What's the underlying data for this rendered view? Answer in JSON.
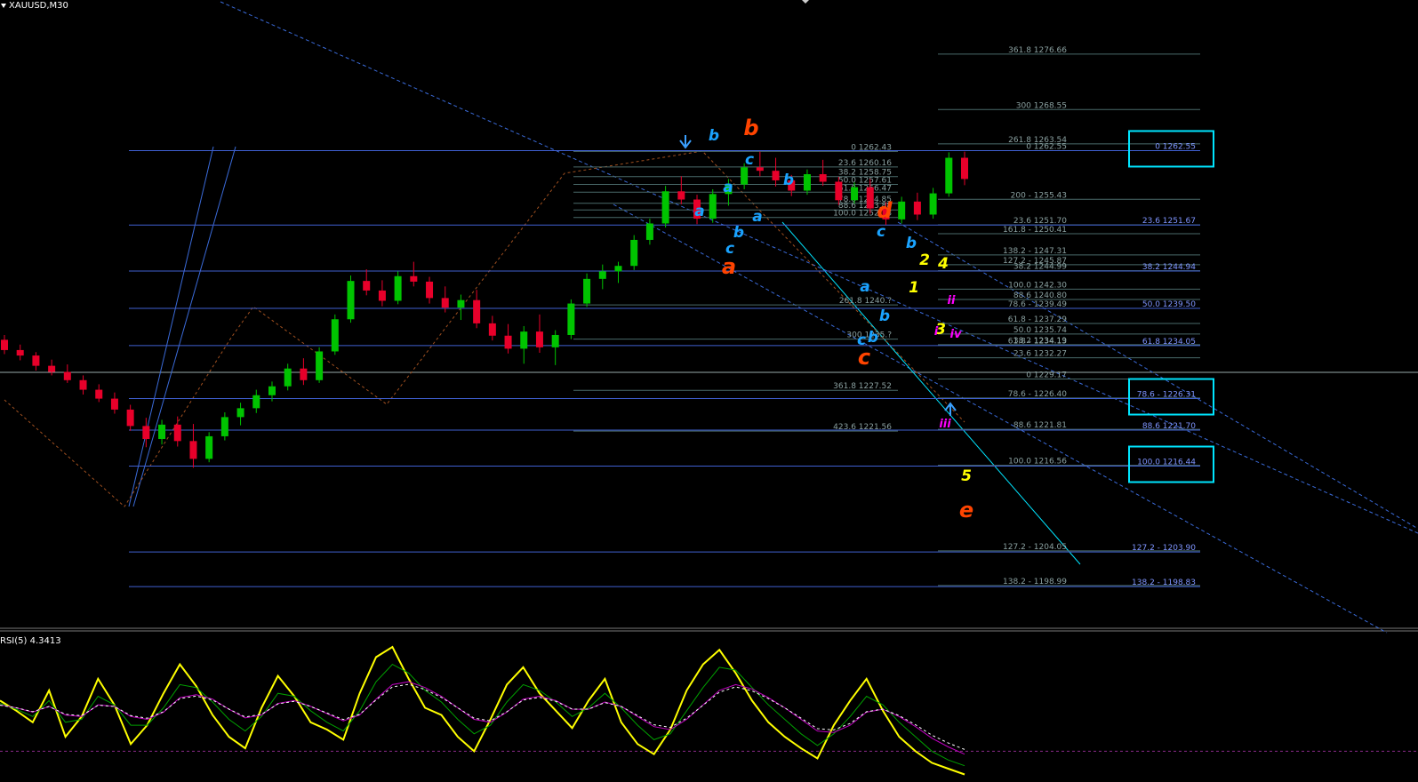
{
  "symbol_title": "XAUUSD,M30",
  "indicator_title": "RSI(5) 4.3413",
  "colors": {
    "background": "#000000",
    "bull": "#00c400",
    "bear": "#e8002a",
    "fib_line": "#4a6a6a",
    "fib_text": "#8aa0a0",
    "level_line": "#3f5fd0",
    "level_text": "#7f95ff",
    "channel": "#3a6ad8",
    "box": "#00e5ff",
    "rsi": "#ffff00"
  },
  "chart_data": [
    {
      "type": "candlestick",
      "title": "XAUUSD,M30",
      "ylim": [
        1193,
        1283
      ],
      "ohlc": [
        [
          1234.9,
          1235.6,
          1232.8,
          1233.4
        ],
        [
          1233.4,
          1234.2,
          1231.9,
          1232.6
        ],
        [
          1232.6,
          1233.1,
          1230.4,
          1231.1
        ],
        [
          1231.1,
          1232.0,
          1229.7,
          1230.2
        ],
        [
          1230.2,
          1231.3,
          1228.6,
          1229.0
        ],
        [
          1229.0,
          1229.7,
          1226.9,
          1227.6
        ],
        [
          1227.6,
          1228.4,
          1225.8,
          1226.3
        ],
        [
          1226.3,
          1227.2,
          1224.1,
          1224.7
        ],
        [
          1224.7,
          1225.4,
          1221.6,
          1222.3
        ],
        [
          1222.3,
          1223.5,
          1219.2,
          1220.4
        ],
        [
          1220.4,
          1223.2,
          1219.6,
          1222.5
        ],
        [
          1222.5,
          1223.7,
          1219.3,
          1220.1
        ],
        [
          1220.1,
          1222.6,
          1216.2,
          1217.5
        ],
        [
          1217.5,
          1221.4,
          1217.0,
          1220.8
        ],
        [
          1220.8,
          1224.3,
          1220.2,
          1223.6
        ],
        [
          1223.6,
          1225.7,
          1222.4,
          1224.9
        ],
        [
          1224.9,
          1227.6,
          1224.2,
          1226.8
        ],
        [
          1226.8,
          1228.8,
          1225.9,
          1228.1
        ],
        [
          1228.1,
          1231.4,
          1227.5,
          1230.7
        ],
        [
          1230.7,
          1232.2,
          1228.3,
          1229.0
        ],
        [
          1229.0,
          1233.8,
          1228.6,
          1233.2
        ],
        [
          1233.2,
          1238.6,
          1232.7,
          1237.9
        ],
        [
          1237.9,
          1244.3,
          1237.4,
          1243.5
        ],
        [
          1243.5,
          1245.2,
          1241.4,
          1242.1
        ],
        [
          1242.1,
          1243.6,
          1239.8,
          1240.6
        ],
        [
          1240.6,
          1244.9,
          1240.1,
          1244.2
        ],
        [
          1244.2,
          1246.3,
          1242.7,
          1243.4
        ],
        [
          1243.4,
          1244.1,
          1240.2,
          1241.0
        ],
        [
          1241.0,
          1242.7,
          1238.9,
          1239.6
        ],
        [
          1239.6,
          1241.5,
          1237.8,
          1240.7
        ],
        [
          1240.7,
          1242.2,
          1236.6,
          1237.3
        ],
        [
          1237.3,
          1238.4,
          1234.8,
          1235.5
        ],
        [
          1235.5,
          1237.2,
          1232.9,
          1233.6
        ],
        [
          1233.6,
          1236.9,
          1231.4,
          1236.1
        ],
        [
          1236.1,
          1238.6,
          1233.0,
          1233.8
        ],
        [
          1233.8,
          1236.3,
          1231.2,
          1235.6
        ],
        [
          1235.6,
          1240.8,
          1235.0,
          1240.2
        ],
        [
          1240.2,
          1244.6,
          1239.7,
          1243.8
        ],
        [
          1243.8,
          1245.9,
          1242.3,
          1244.9
        ],
        [
          1244.9,
          1246.3,
          1243.2,
          1245.7
        ],
        [
          1245.7,
          1250.2,
          1245.1,
          1249.5
        ],
        [
          1249.5,
          1252.6,
          1248.8,
          1251.9
        ],
        [
          1251.9,
          1257.4,
          1251.3,
          1256.6
        ],
        [
          1256.6,
          1258.8,
          1254.7,
          1255.4
        ],
        [
          1255.4,
          1256.1,
          1251.8,
          1252.6
        ],
        [
          1252.6,
          1256.9,
          1252.0,
          1256.2
        ],
        [
          1256.2,
          1258.4,
          1254.5,
          1257.6
        ],
        [
          1257.6,
          1260.7,
          1256.9,
          1260.1
        ],
        [
          1260.1,
          1262.4,
          1258.8,
          1259.6
        ],
        [
          1259.6,
          1261.5,
          1257.3,
          1258.2
        ],
        [
          1258.2,
          1259.0,
          1255.9,
          1256.7
        ],
        [
          1256.7,
          1259.8,
          1256.1,
          1259.1
        ],
        [
          1259.1,
          1261.2,
          1257.4,
          1258.0
        ],
        [
          1258.0,
          1258.7,
          1254.6,
          1255.3
        ],
        [
          1255.3,
          1257.9,
          1254.8,
          1257.2
        ],
        [
          1257.2,
          1258.4,
          1253.3,
          1254.1
        ],
        [
          1254.1,
          1255.0,
          1251.7,
          1252.5
        ],
        [
          1252.5,
          1255.8,
          1251.9,
          1255.1
        ],
        [
          1255.1,
          1256.4,
          1252.4,
          1253.2
        ],
        [
          1253.2,
          1257.1,
          1252.6,
          1256.3
        ],
        [
          1256.3,
          1262.3,
          1255.8,
          1261.5
        ],
        [
          1261.5,
          1262.4,
          1257.5,
          1258.4
        ]
      ],
      "fib_levels_cluster_1": [
        {
          "label": "0 1262.43",
          "value": 1262.43
        },
        {
          "label": "23.6 1260.16",
          "value": 1260.16
        },
        {
          "label": "38.2 1258.75",
          "value": 1258.75
        },
        {
          "label": "50.0 1257.61",
          "value": 1257.61
        },
        {
          "label": "61.8 1256.47",
          "value": 1256.47
        },
        {
          "label": "78.6 1254.85",
          "value": 1254.85
        },
        {
          "label": "88.6 1253.88",
          "value": 1253.88
        },
        {
          "label": "100.0 1252.78",
          "value": 1252.78
        },
        {
          "label": "261.8 1240.?",
          "value": 1240.0
        },
        {
          "label": "300 1235.?",
          "value": 1235.0
        },
        {
          "label": "361.8 1227.52",
          "value": 1227.52
        },
        {
          "label": "423.6 1221.56",
          "value": 1221.56
        }
      ],
      "fib_levels_cluster_2": [
        {
          "label": "361.8 1276.66",
          "value": 1276.66
        },
        {
          "label": "300 1268.55",
          "value": 1268.55
        },
        {
          "label": "261.8 1263.54",
          "value": 1263.54
        },
        {
          "label": "0 1262.55",
          "value": 1262.55
        },
        {
          "label": "200 - 1255.43",
          "value": 1255.43
        },
        {
          "label": "23.6 1251.70",
          "value": 1251.7
        },
        {
          "label": "161.8 - 1250.41",
          "value": 1250.41
        },
        {
          "label": "138.2 - 1247.31",
          "value": 1247.31
        },
        {
          "label": "127.2 - 1245.87",
          "value": 1245.87
        },
        {
          "label": "38.2 1244.99",
          "value": 1244.99
        },
        {
          "label": "100.0 1242.30",
          "value": 1242.3
        },
        {
          "label": "88.6 1240.80",
          "value": 1240.8
        },
        {
          "label": "78.6 - 1239.49",
          "value": 1239.49
        },
        {
          "label": "61.8 - 1237.29",
          "value": 1237.29
        },
        {
          "label": "50.0 1235.74",
          "value": 1235.74
        },
        {
          "label": "38.2 1234.19",
          "value": 1234.19
        },
        {
          "label": "61.8 - 1234.13",
          "value": 1234.13
        },
        {
          "label": "23.6 1232.27",
          "value": 1232.27
        },
        {
          "label": "0 1229.17",
          "value": 1229.17
        },
        {
          "label": "78.6 - 1226.40",
          "value": 1226.4
        },
        {
          "label": "88.6 1221.81",
          "value": 1221.81
        },
        {
          "label": "100.0 1216.56",
          "value": 1216.56
        },
        {
          "label": "127.2 - 1204.05",
          "value": 1204.05
        },
        {
          "label": "138.2 - 1198.99",
          "value": 1198.99
        }
      ],
      "right_levels": [
        {
          "label": "0 1262.55",
          "value": 1262.55,
          "boxed": true
        },
        {
          "label": "23.6 1251.67",
          "value": 1251.67,
          "boxed": false
        },
        {
          "label": "38.2 1244.94",
          "value": 1244.94,
          "boxed": false
        },
        {
          "label": "50.0 1239.50",
          "value": 1239.5,
          "boxed": false
        },
        {
          "label": "61.8 1234.05",
          "value": 1234.05,
          "boxed": false
        },
        {
          "label": "78.6 - 1226.31",
          "value": 1226.31,
          "boxed": true
        },
        {
          "label": "88.6 1221.70",
          "value": 1221.7,
          "boxed": false
        },
        {
          "label": "100.0 1216.44",
          "value": 1216.44,
          "boxed": true
        },
        {
          "label": "127.2 - 1203.90",
          "value": 1203.9,
          "boxed": false
        },
        {
          "label": "138.2 - 1198.83",
          "value": 1198.83,
          "boxed": false
        }
      ],
      "wave_labels": [
        {
          "text": "b",
          "color": "#ff4400",
          "size": "large"
        },
        {
          "text": "a",
          "color": "#ff4400",
          "size": "large"
        },
        {
          "text": "d",
          "color": "#ff4400",
          "size": "large"
        },
        {
          "text": "c",
          "color": "#ff4400",
          "size": "large"
        },
        {
          "text": "e",
          "color": "#ff4400",
          "size": "large"
        },
        {
          "text": "b",
          "color": "#1aa3ff",
          "size": "medium"
        },
        {
          "text": "c",
          "color": "#1aa3ff",
          "size": "medium"
        },
        {
          "text": "a",
          "color": "#1aa3ff",
          "size": "medium"
        },
        {
          "text": "b",
          "color": "#1aa3ff",
          "size": "medium"
        },
        {
          "text": "c",
          "color": "#1aa3ff",
          "size": "medium"
        },
        {
          "text": "a",
          "color": "#1aa3ff",
          "size": "medium"
        },
        {
          "text": "b",
          "color": "#1aa3ff",
          "size": "medium"
        },
        {
          "text": "a",
          "color": "#1aa3ff",
          "size": "medium"
        },
        {
          "text": "b",
          "color": "#1aa3ff",
          "size": "medium"
        },
        {
          "text": "c",
          "color": "#1aa3ff",
          "size": "medium"
        },
        {
          "text": "a",
          "color": "#1aa3ff",
          "size": "medium"
        },
        {
          "text": "b",
          "color": "#1aa3ff",
          "size": "medium"
        },
        {
          "text": "c",
          "color": "#1aa3ff",
          "size": "medium"
        },
        {
          "text": "b",
          "color": "#1aa3ff",
          "size": "medium"
        },
        {
          "text": "2",
          "color": "#ffff00",
          "size": "medium"
        },
        {
          "text": "1",
          "color": "#ffff00",
          "size": "medium"
        },
        {
          "text": "3",
          "color": "#ffff00",
          "size": "medium"
        },
        {
          "text": "4",
          "color": "#ffff00",
          "size": "medium"
        },
        {
          "text": "5",
          "color": "#ffff00",
          "size": "medium"
        },
        {
          "text": "ii",
          "color": "#ff00ff",
          "size": "small"
        },
        {
          "text": "i",
          "color": "#ff00ff",
          "size": "small"
        },
        {
          "text": "iv",
          "color": "#ff00ff",
          "size": "small"
        },
        {
          "text": "iii",
          "color": "#ff00ff",
          "size": "small"
        }
      ]
    },
    {
      "type": "line",
      "title": "RSI(5) 4.3413",
      "ylim": [
        0,
        100
      ],
      "series": [
        {
          "values": [
            55,
            48,
            40,
            62,
            30,
            44,
            70,
            52,
            25,
            38,
            60,
            80,
            65,
            45,
            30,
            22,
            50,
            72,
            58,
            40,
            35,
            28,
            60,
            85,
            92,
            70,
            50,
            45,
            30,
            20,
            42,
            66,
            78,
            60,
            48,
            36,
            55,
            70,
            40,
            25,
            18,
            35,
            62,
            80,
            90,
            74,
            55,
            40,
            30,
            22,
            15,
            38,
            55,
            70,
            48,
            30,
            20,
            12,
            8,
            4
          ]
        },
        {
          "values": [
            53,
            49,
            44,
            55,
            40,
            42,
            58,
            52,
            38,
            38,
            50,
            66,
            64,
            54,
            42,
            34,
            44,
            60,
            58,
            48,
            40,
            34,
            48,
            68,
            80,
            74,
            62,
            54,
            42,
            32,
            38,
            54,
            66,
            62,
            54,
            44,
            50,
            60,
            50,
            38,
            28,
            32,
            48,
            64,
            78,
            76,
            64,
            52,
            42,
            32,
            24,
            32,
            44,
            58,
            52,
            40,
            30,
            20,
            14,
            10
          ]
        },
        {
          "values": [
            52,
            50,
            47,
            51,
            45,
            44,
            52,
            51,
            44,
            42,
            47,
            57,
            59,
            56,
            49,
            43,
            45,
            53,
            55,
            51,
            46,
            41,
            45,
            56,
            66,
            68,
            64,
            58,
            50,
            42,
            40,
            47,
            56,
            58,
            55,
            49,
            49,
            54,
            51,
            44,
            37,
            35,
            42,
            52,
            62,
            66,
            63,
            57,
            50,
            42,
            34,
            33,
            38,
            47,
            49,
            44,
            37,
            29,
            23,
            18
          ]
        }
      ],
      "dashed_level": 20
    }
  ]
}
